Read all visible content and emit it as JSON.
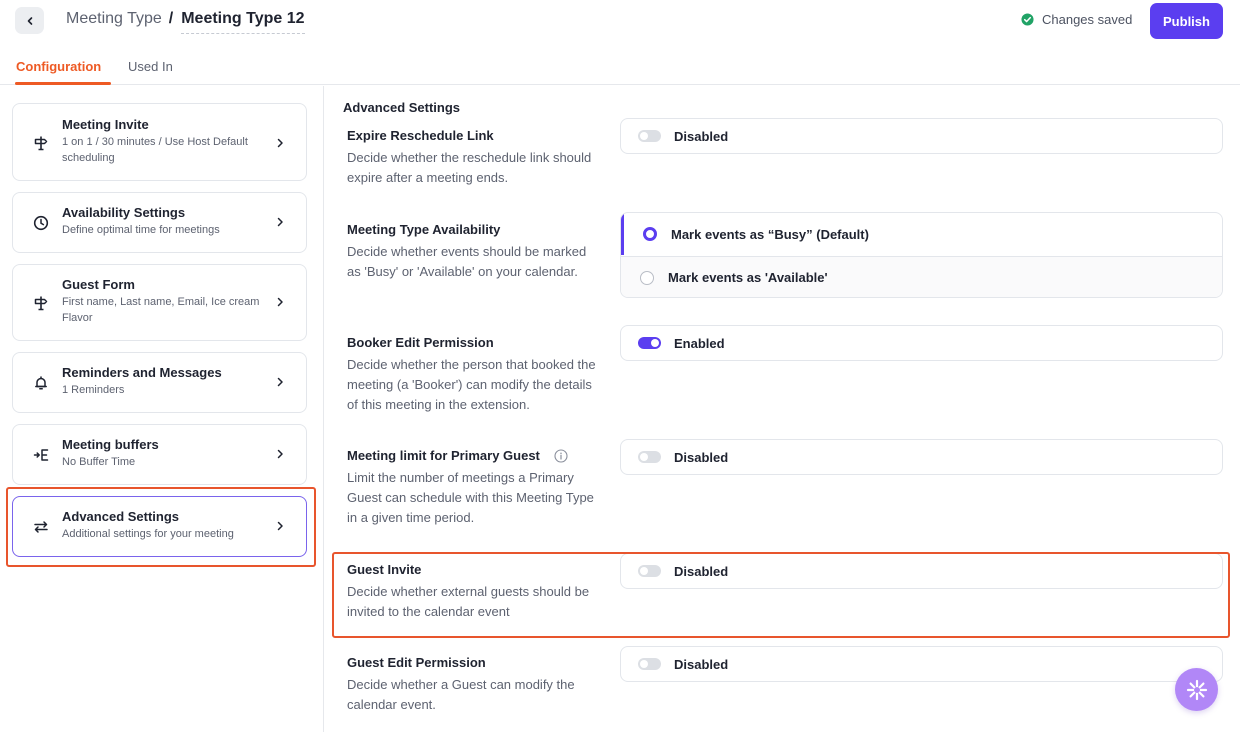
{
  "header": {
    "breadcrumb_parent": "Meeting Type",
    "breadcrumb_separator": "/",
    "title": "Meeting Type 12",
    "status": "Changes saved",
    "publish_label": "Publish",
    "accent": "#5b3ef0",
    "status_color": "#21a366"
  },
  "tabs": [
    {
      "label": "Configuration",
      "active": true
    },
    {
      "label": "Used In",
      "active": false
    }
  ],
  "sidebar": {
    "items": [
      {
        "title": "Meeting Invite",
        "subtitle": "1 on 1 / 30 minutes / Use Host Default scheduling",
        "icon": "signpost-icon"
      },
      {
        "title": "Availability Settings",
        "subtitle": "Define optimal time for meetings",
        "icon": "clock-icon"
      },
      {
        "title": "Guest Form",
        "subtitle": "First name, Last name, Email, Ice cream Flavor",
        "icon": "signpost-icon"
      },
      {
        "title": "Reminders and Messages",
        "subtitle": "1 Reminders",
        "icon": "bell-icon"
      },
      {
        "title": "Meeting buffers",
        "subtitle": "No Buffer Time",
        "icon": "buffer-icon"
      },
      {
        "title": "Advanced Settings",
        "subtitle": "Additional settings for your meeting",
        "icon": "sliders-icon",
        "active": true
      }
    ]
  },
  "main": {
    "section_title": "Advanced Settings",
    "settings": {
      "expire_reschedule": {
        "title": "Expire Reschedule Link",
        "description": "Decide whether the reschedule link should expire after a meeting ends.",
        "state_label": "Disabled",
        "enabled": false
      },
      "availability": {
        "title": "Meeting Type Availability",
        "description": "Decide whether events should be marked as 'Busy' or 'Available' on your calendar.",
        "options": [
          "Mark events as “Busy” (Default)",
          "Mark events as 'Available'"
        ],
        "selected": 0
      },
      "booker_edit": {
        "title": "Booker Edit Permission",
        "description": "Decide whether the person that booked the meeting (a 'Booker') can modify the details of this meeting in the extension.",
        "state_label": "Enabled",
        "enabled": true
      },
      "meeting_limit": {
        "title": "Meeting limit for Primary Guest",
        "description": "Limit the number of meetings a Primary Guest can schedule with this Meeting Type in a given time period.",
        "state_label": "Disabled",
        "enabled": false
      },
      "guest_invite": {
        "title": "Guest Invite",
        "description": "Decide whether external guests should be invited to the calendar event",
        "state_label": "Disabled",
        "enabled": false
      },
      "guest_edit": {
        "title": "Guest Edit Permission",
        "description": "Decide whether a Guest can modify the calendar event.",
        "state_label": "Disabled",
        "enabled": false
      }
    }
  },
  "highlight_color": "#e8552d"
}
